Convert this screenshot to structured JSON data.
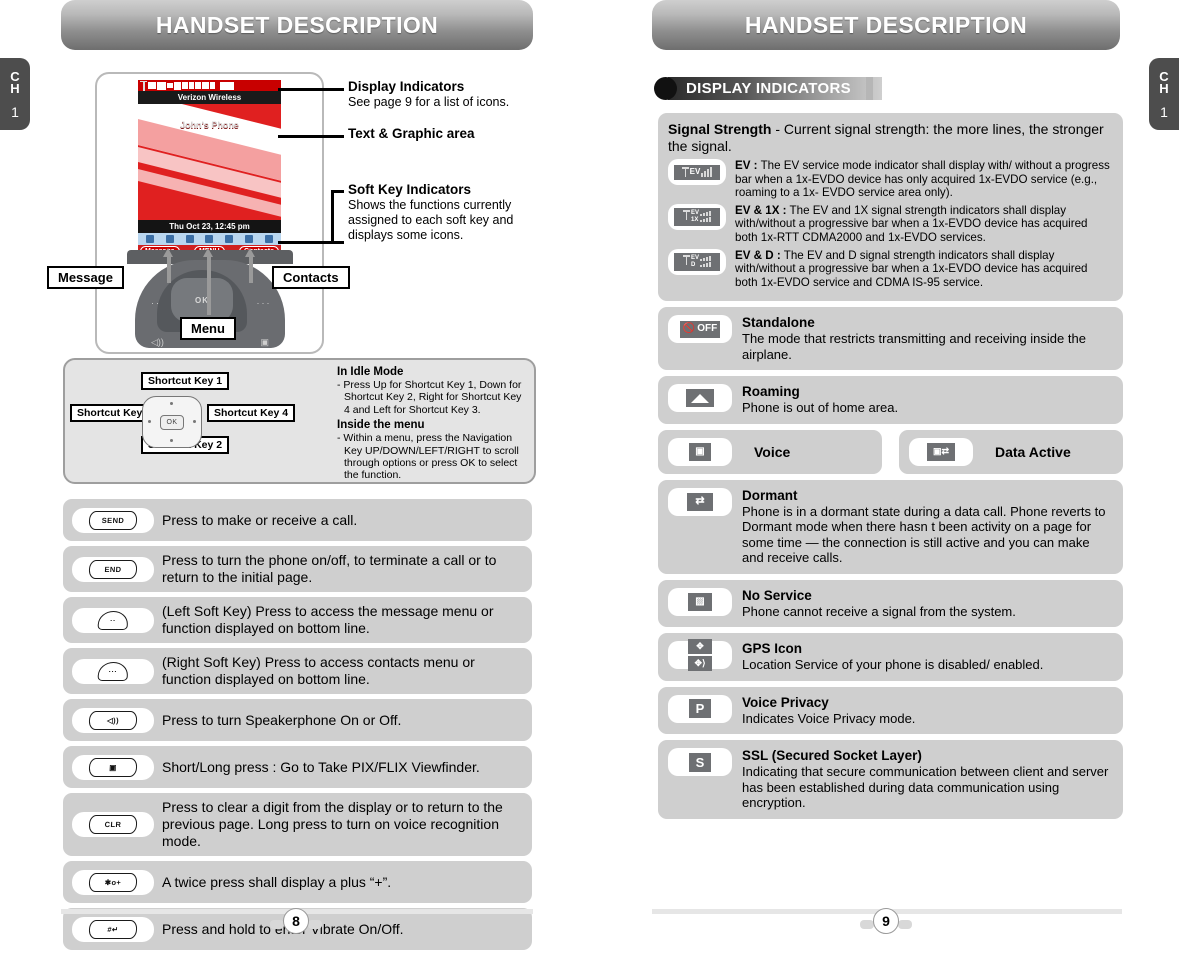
{
  "left_page": {
    "banner_title": "HANDSET DESCRIPTION",
    "chapter_tab": {
      "ch": "C\nH",
      "ch_line1": "C",
      "ch_line2": "H",
      "number": "1"
    },
    "phone": {
      "carrier": "Verizon Wireless",
      "wallpaper_text": "John's Phone",
      "date_time": "Thu Oct 23, 12:45 pm",
      "soft_left": "Message",
      "soft_mid": "MENU",
      "soft_right": "Contacts"
    },
    "overlay_labels": {
      "message": "Message",
      "contacts": "Contacts",
      "menu": "Menu"
    },
    "callouts": [
      {
        "title": "Display Indicators",
        "body": "See page 9 for a list of icons."
      },
      {
        "title": "Text & Graphic area",
        "body": ""
      },
      {
        "title": "Soft Key Indicators",
        "body": "Shows the functions currently assigned to each soft key and displays some icons."
      }
    ],
    "idle_panel": {
      "shortcut_key_1": "Shortcut Key 1",
      "shortcut_key_2": "Shortcut Key 2",
      "shortcut_key_3": "Shortcut Key 3",
      "shortcut_key_4": "Shortcut Key 4",
      "navkey_label": "OK",
      "idle_heading": "In Idle Mode",
      "idle_text": "- Press Up for Shortcut Key 1, Down for Shortcut Key 2, Right for Shortcut Key 4 and Left for Shortcut Key 3.",
      "menu_heading": "Inside the menu",
      "menu_text": "- Within a menu, press the Navigation Key UP/DOWN/LEFT/RIGHT to scroll through options or press OK to select the function."
    },
    "key_rows": [
      {
        "key": "SEND",
        "icon": "send-key-icon",
        "text": "Press to make or receive a call."
      },
      {
        "key": "END",
        "icon": "end-key-icon",
        "text": "Press to turn the phone on/off, to terminate a call or to return to the initial page."
      },
      {
        "key": "",
        "icon": "left-soft-key-icon",
        "text": "(Left Soft Key) Press to access the message menu or function displayed on bottom line."
      },
      {
        "key": "",
        "icon": "right-soft-key-icon",
        "text": "(Right Soft Key) Press to access contacts menu or function displayed on bottom line."
      },
      {
        "key": "",
        "icon": "speakerphone-key-icon",
        "text": "Press to turn Speakerphone On or Off."
      },
      {
        "key": "",
        "icon": "camera-key-icon",
        "text": "Short/Long press : Go to Take PIX/FLIX Viewfinder."
      },
      {
        "key": "CLR",
        "icon": "clear-key-icon",
        "text": "Press to clear a digit from the display or to return to the previous page. Long press to turn on voice recognition mode."
      },
      {
        "key": "*",
        "icon": "star-key-icon",
        "text": "A twice press shall display a plus “+”."
      },
      {
        "key": "#",
        "icon": "pound-key-icon",
        "text": "Press and hold to enter Vibrate On/Off."
      }
    ],
    "page_number": "8"
  },
  "right_page": {
    "banner_title": "HANDSET DESCRIPTION",
    "chapter_tab": {
      "ch_line1": "C",
      "ch_line2": "H",
      "number": "1"
    },
    "section_header": "DISPLAY INDICATORS",
    "signal_strength": {
      "title": "Signal Strength",
      "subtitle": " - Current signal strength: the more lines, the stronger the signal.",
      "items": [
        {
          "icon_label": "EV",
          "icon_name": "signal-ev-icon",
          "term": "EV :",
          "text": " The  EV  service mode indicator shall display with/ without a progress bar when a 1x-EVDO device has only acquired 1x-EVDO service (e.g., roaming to a 1x- EVDO service area only)."
        },
        {
          "icon_label": "EV 1X",
          "icon_name": "signal-ev-1x-icon",
          "term": "EV & 1X :",
          "text": " The  EV  and  1X  signal strength indicators shall display with/without a progressive bar when a 1x-EVDO device has acquired both 1x-RTT CDMA2000 and 1x-EVDO services."
        },
        {
          "icon_label": "EV D",
          "icon_name": "signal-ev-d-icon",
          "term": "EV & D :",
          "text": " The  EV  and  D  signal strength indicators shall display with/without a progressive bar when a 1x-EVDO device has acquired both 1x-EVDO service and CDMA IS-95 service."
        }
      ]
    },
    "indicators": [
      {
        "icon_name": "standalone-off-icon",
        "icon_label": "OFF",
        "title": "Standalone",
        "text": "The mode that restricts transmitting and receiving inside the airplane."
      },
      {
        "icon_name": "roaming-icon",
        "icon_label": "",
        "title": "Roaming",
        "text": "Phone is out of home area."
      },
      {
        "icon_name": "dormant-icon",
        "icon_label": "",
        "title": "Dormant",
        "text": "Phone is in a dormant state during a data call. Phone reverts to Dormant mode when there hasn t been activity on a page for some time — the connection is still active and you can make and receive calls."
      },
      {
        "icon_name": "no-service-icon",
        "icon_label": "",
        "title": "No Service",
        "text": "Phone cannot receive a signal from the system."
      },
      {
        "icon_name": "gps-icon",
        "icon_label": "",
        "title": "GPS Icon",
        "text": "Location Service of your phone is disabled/ enabled."
      },
      {
        "icon_name": "voice-privacy-icon",
        "icon_label": "P",
        "title": "Voice Privacy",
        "text": "Indicates  Voice Privacy  mode."
      },
      {
        "icon_name": "ssl-icon",
        "icon_label": "S",
        "title": "SSL (Secured Socket Layer)",
        "text": "Indicating that secure communication between client and server has been established during data communication using encryption."
      }
    ],
    "pair_row": [
      {
        "icon_name": "voice-icon",
        "title": "Voice"
      },
      {
        "icon_name": "data-active-icon",
        "title": "Data Active"
      }
    ],
    "page_number": "9"
  }
}
